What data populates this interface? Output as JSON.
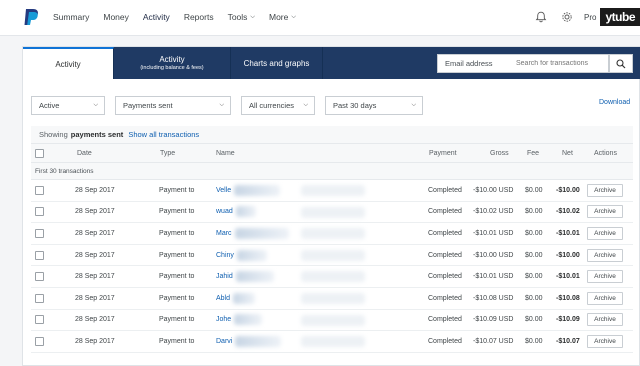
{
  "nav": {
    "items": [
      {
        "label": "Summary"
      },
      {
        "label": "Money"
      },
      {
        "label": "Activity"
      },
      {
        "label": "Reports"
      },
      {
        "label": "Tools",
        "chevron": true
      },
      {
        "label": "More",
        "chevron": true
      }
    ],
    "profile_label": "Pro",
    "overlay_text": "ytube"
  },
  "tabs": [
    {
      "label": "Activity",
      "sub": ""
    },
    {
      "label": "Activity",
      "sub": "(including balance & fees)"
    },
    {
      "label": "Charts and graphs",
      "sub": ""
    }
  ],
  "search": {
    "field_select": "Email address",
    "placeholder": "Search for transactions"
  },
  "filters": {
    "status": "Active",
    "type": "Payments sent",
    "currency": "All currencies",
    "period": "Past 30 days"
  },
  "download_label": "Download",
  "showing": {
    "prefix": "Showing",
    "bold": "payments sent",
    "link": "Show all transactions"
  },
  "columns": {
    "date": "Date",
    "type": "Type",
    "name": "Name",
    "payment": "Payment",
    "gross": "Gross",
    "fee": "Fee",
    "net": "Net",
    "actions": "Actions"
  },
  "group_label": "First 30 transactions",
  "rows": [
    {
      "date": "28 Sep 2017",
      "type": "Payment to",
      "name": "Velle",
      "payment": "Completed",
      "gross": "-$10.00 USD",
      "fee": "$0.00",
      "net": "-$10.00",
      "action": "Archive"
    },
    {
      "date": "28 Sep 2017",
      "type": "Payment to",
      "name": "wuad",
      "payment": "Completed",
      "gross": "-$10.02 USD",
      "fee": "$0.00",
      "net": "-$10.02",
      "action": "Archive"
    },
    {
      "date": "28 Sep 2017",
      "type": "Payment to",
      "name": "Marc",
      "payment": "Completed",
      "gross": "-$10.01 USD",
      "fee": "$0.00",
      "net": "-$10.01",
      "action": "Archive"
    },
    {
      "date": "28 Sep 2017",
      "type": "Payment to",
      "name": "Chiny",
      "payment": "Completed",
      "gross": "-$10.00 USD",
      "fee": "$0.00",
      "net": "-$10.00",
      "action": "Archive"
    },
    {
      "date": "28 Sep 2017",
      "type": "Payment to",
      "name": "Jahid",
      "payment": "Completed",
      "gross": "-$10.01 USD",
      "fee": "$0.00",
      "net": "-$10.01",
      "action": "Archive"
    },
    {
      "date": "28 Sep 2017",
      "type": "Payment to",
      "name": "Abld",
      "payment": "Completed",
      "gross": "-$10.08 USD",
      "fee": "$0.00",
      "net": "-$10.08",
      "action": "Archive"
    },
    {
      "date": "28 Sep 2017",
      "type": "Payment to",
      "name": "Johe",
      "payment": "Completed",
      "gross": "-$10.09 USD",
      "fee": "$0.00",
      "net": "-$10.09",
      "action": "Archive"
    },
    {
      "date": "28 Sep 2017",
      "type": "Payment to",
      "name": "Darvi",
      "payment": "Completed",
      "gross": "-$10.07 USD",
      "fee": "$0.00",
      "net": "-$10.07",
      "action": "Archive"
    }
  ]
}
